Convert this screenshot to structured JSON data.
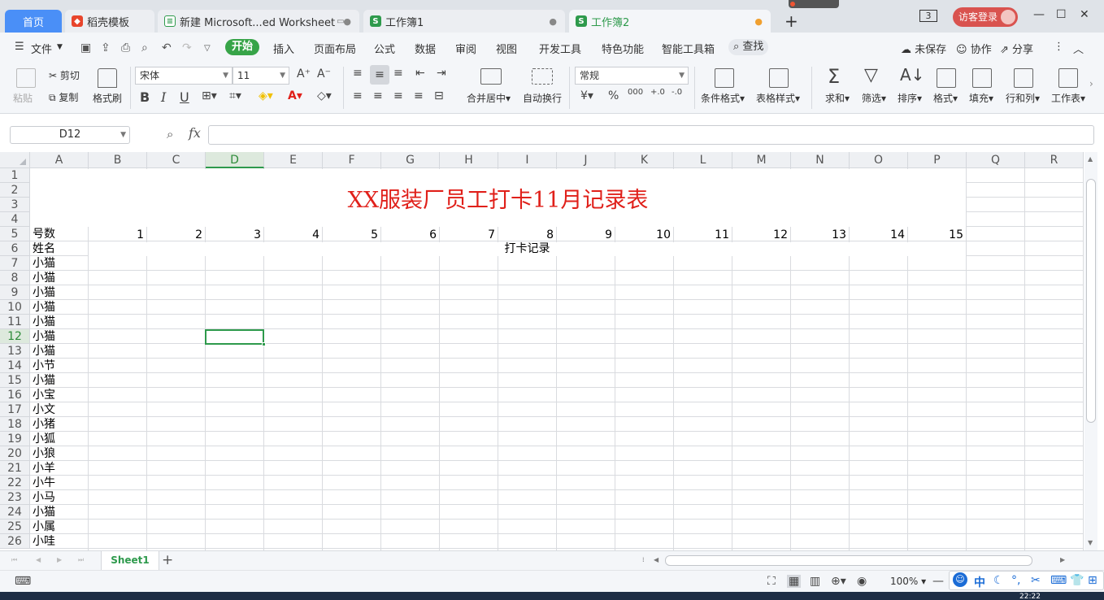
{
  "tabs": {
    "home": "首页",
    "t1": "稻壳模板",
    "t2": "新建 Microsoft...ed Worksheet",
    "t3": "工作簿1",
    "t4": "工作簿2"
  },
  "window": {
    "badge": "3",
    "login": "访客登录"
  },
  "menu": {
    "file": "文件",
    "items": [
      "开始",
      "插入",
      "页面布局",
      "公式",
      "数据",
      "审阅",
      "视图",
      "开发工具",
      "特色功能",
      "智能工具箱"
    ],
    "search": "查找",
    "unsaved": "未保存",
    "collab": "协作",
    "share": "分享"
  },
  "ribbon": {
    "paste": "粘贴",
    "cut": "剪切",
    "copy": "复制",
    "format_painter": "格式刷",
    "font_name": "宋体",
    "font_size": "11",
    "merge": "合并居中",
    "wrap": "自动换行",
    "num_format": "常规",
    "cond_format": "条件格式",
    "table_style": "表格样式",
    "sum": "求和",
    "filter": "筛选",
    "sort": "排序",
    "format": "格式",
    "fill": "填充",
    "rowcol": "行和列",
    "worksheet": "工作表",
    "currency": "¥",
    "percent": "%",
    "thousands": "000",
    "inc_dec": "+.0",
    "dec_dec": "-.0"
  },
  "formula": {
    "name_box": "D12",
    "fx": "fx",
    "content": ""
  },
  "columns": [
    "A",
    "B",
    "C",
    "D",
    "E",
    "F",
    "G",
    "H",
    "I",
    "J",
    "K",
    "L",
    "M",
    "N",
    "O",
    "P",
    "Q",
    "R"
  ],
  "rows": [
    "1",
    "2",
    "3",
    "4",
    "5",
    "6",
    "7",
    "8",
    "9",
    "10",
    "11",
    "12",
    "13",
    "14",
    "15",
    "16",
    "17",
    "18",
    "19",
    "20",
    "21",
    "22",
    "23",
    "24",
    "25",
    "26"
  ],
  "sheet": {
    "title": "XX服装厂员工打卡11月记录表",
    "row5_label": "号数",
    "row6_label": "姓名",
    "days": [
      "1",
      "2",
      "3",
      "4",
      "5",
      "6",
      "7",
      "8",
      "9",
      "10",
      "11",
      "12",
      "13",
      "14",
      "15"
    ],
    "record_header": "打卡记录",
    "names": [
      "小猫",
      "小猫",
      "小猫",
      "小猫",
      "小猫",
      "小猫",
      "小猫",
      "小节",
      "小猫",
      "小宝",
      "小文",
      "小猪",
      "小狐",
      "小狼",
      "小羊",
      "小牛",
      "小马",
      "小猫",
      "小属",
      "小哇"
    ]
  },
  "sheetbar": {
    "tab": "Sheet1"
  },
  "status": {
    "zoom": "100%"
  },
  "ime": {
    "lang": "中"
  },
  "taskbar": {
    "time": "22:22"
  }
}
